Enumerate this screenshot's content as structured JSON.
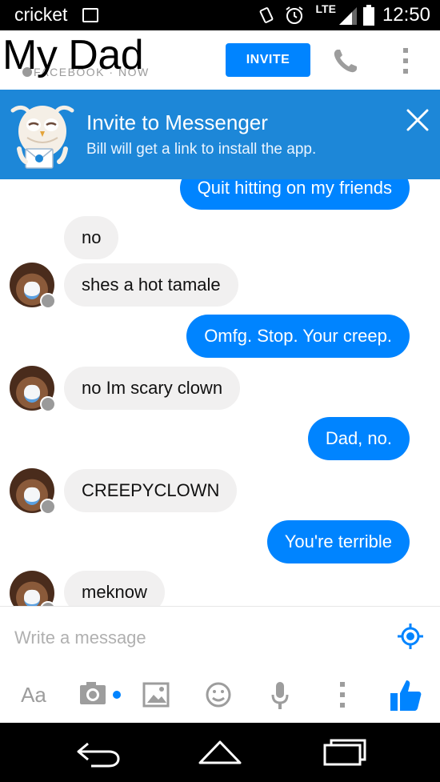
{
  "status_bar": {
    "carrier": "cricket",
    "network": "LTE",
    "time": "12:50"
  },
  "header": {
    "title": "My Dad",
    "subtitle": "FACEBOOK · NOW",
    "invite_label": "INVITE"
  },
  "banner": {
    "title": "Invite to Messenger",
    "text": "Bill will get a link to install the app."
  },
  "messages": [
    {
      "direction": "out",
      "text": "Quit hitting on my friends"
    },
    {
      "direction": "in",
      "text": "no"
    },
    {
      "direction": "in",
      "text": "shes a hot tamale"
    },
    {
      "direction": "out",
      "text": "Omfg. Stop. Your creep."
    },
    {
      "direction": "in",
      "text": "no Im scary clown"
    },
    {
      "direction": "out",
      "text": "Dad, no."
    },
    {
      "direction": "in",
      "text": "CREEPYCLOWN"
    },
    {
      "direction": "out",
      "text": "You're terrible"
    },
    {
      "direction": "in",
      "text": "meknow"
    }
  ],
  "composer": {
    "placeholder": "Write a message",
    "text_format_label": "Aa"
  },
  "colors": {
    "accent": "#0084ff",
    "banner": "#1d87d8",
    "incoming_bubble": "#f1f0f0",
    "icon_gray": "#9d9d9d"
  },
  "icons": {
    "status_bar": [
      "photo-notification-icon",
      "vibrate-icon",
      "alarm-icon",
      "signal-icon",
      "battery-icon"
    ],
    "header": [
      "phone-icon",
      "more-vertical-icon"
    ],
    "banner": [
      "owl-mascot-icon",
      "close-icon"
    ],
    "composer": [
      "location-icon",
      "camera-icon",
      "gallery-icon",
      "emoji-icon",
      "microphone-icon",
      "more-vertical-icon",
      "thumbs-up-icon"
    ],
    "navigation": [
      "back-icon",
      "home-icon",
      "recents-icon"
    ]
  }
}
